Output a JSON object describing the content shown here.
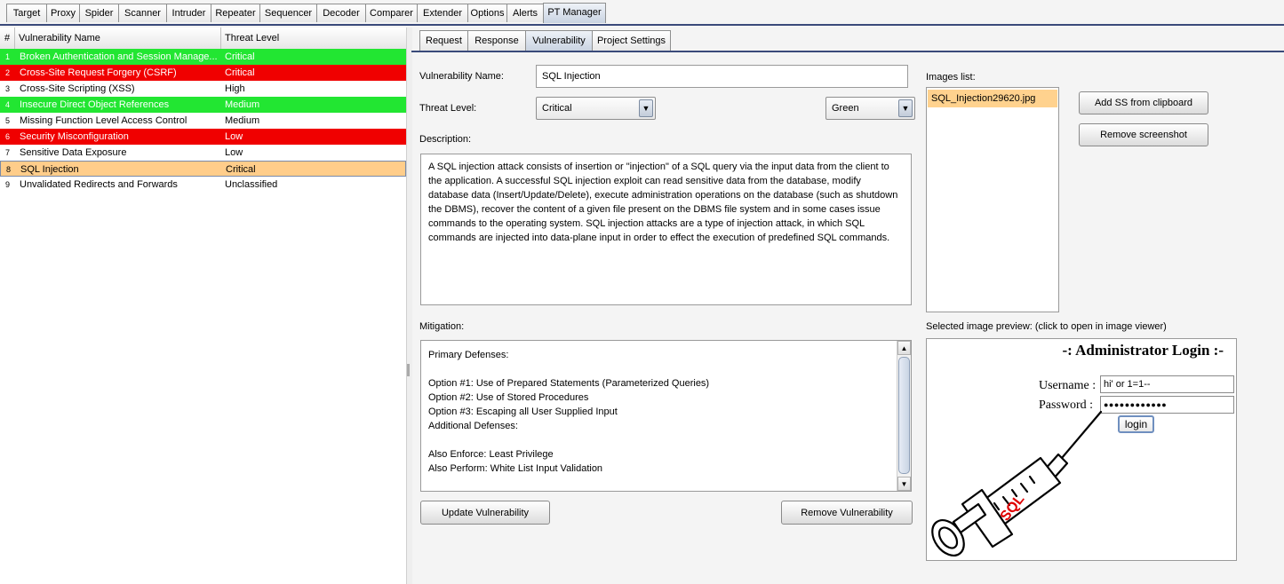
{
  "top_tabs": {
    "items": [
      {
        "label": "Target"
      },
      {
        "label": "Proxy"
      },
      {
        "label": "Spider"
      },
      {
        "label": "Scanner"
      },
      {
        "label": "Intruder"
      },
      {
        "label": "Repeater"
      },
      {
        "label": "Sequencer"
      },
      {
        "label": "Decoder"
      },
      {
        "label": "Comparer"
      },
      {
        "label": "Extender"
      },
      {
        "label": "Options"
      },
      {
        "label": "Alerts"
      },
      {
        "label": "PT Manager"
      }
    ],
    "active": "PT Manager"
  },
  "vuln_table": {
    "headers": {
      "num": "#",
      "name": "Vulnerability Name",
      "threat": "Threat Level"
    },
    "rows": [
      {
        "num": "1",
        "name": "Broken Authentication and Session Manage...",
        "threat": "Critical",
        "color": "#22e632",
        "text_color": "#ffffff"
      },
      {
        "num": "2",
        "name": "Cross-Site Request Forgery (CSRF)",
        "threat": "Critical",
        "color": "#f00000",
        "text_color": "#ffffff"
      },
      {
        "num": "3",
        "name": "Cross-Site Scripting (XSS)",
        "threat": "High",
        "color": "#ffffff",
        "text_color": "#000000"
      },
      {
        "num": "4",
        "name": "Insecure Direct Object References",
        "threat": "Medium",
        "color": "#22e632",
        "text_color": "#ffffff"
      },
      {
        "num": "5",
        "name": "Missing Function Level Access Control",
        "threat": "Medium",
        "color": "#ffffff",
        "text_color": "#000000"
      },
      {
        "num": "6",
        "name": "Security Misconfiguration",
        "threat": "Low",
        "color": "#f00000",
        "text_color": "#ffffff"
      },
      {
        "num": "7",
        "name": "Sensitive Data Exposure",
        "threat": "Low",
        "color": "#ffffff",
        "text_color": "#000000"
      },
      {
        "num": "8",
        "name": "SQL Injection",
        "threat": "Critical",
        "color": "#ffcd8a",
        "text_color": "#000000",
        "selected": true
      },
      {
        "num": "9",
        "name": "Unvalidated Redirects and Forwards",
        "threat": "Unclassified",
        "color": "#ffffff",
        "text_color": "#000000"
      }
    ]
  },
  "sub_tabs": {
    "items": [
      {
        "label": "Request"
      },
      {
        "label": "Response"
      },
      {
        "label": "Vulnerability"
      },
      {
        "label": "Project Settings"
      }
    ],
    "active": "Vulnerability"
  },
  "form": {
    "name_label": "Vulnerability Name:",
    "name_value": "SQL Injection",
    "threat_label": "Threat Level:",
    "threat_value": "Critical",
    "color_value": "Green",
    "description_label": "Description:",
    "description_text": "A SQL injection attack consists of insertion or \"injection\" of a SQL query via the input data from the client to the application. A successful SQL injection exploit can read sensitive data from the database, modify database data (Insert/Update/Delete), execute administration operations on the database (such as shutdown the DBMS), recover the content of a given file present on the DBMS file system and in some cases issue commands to the operating system. SQL injection attacks are a type of injection attack, in which SQL commands are injected into data-plane input in order to effect the execution of predefined SQL commands.",
    "mitigation_label": "Mitigation:",
    "mitigation_lines": [
      "Primary Defenses:",
      "",
      "Option #1: Use of Prepared Statements (Parameterized Queries)",
      "Option #2: Use of Stored Procedures",
      "Option #3: Escaping all User Supplied Input",
      "Additional Defenses:",
      "",
      "Also Enforce: Least Privilege",
      "Also Perform: White List Input Validation"
    ],
    "update_button": "Update Vulnerability",
    "remove_button": "Remove Vulnerability"
  },
  "images": {
    "list_label": "Images list:",
    "items": [
      "SQL_Injection29620.jpg"
    ],
    "add_button": "Add SS from clipboard",
    "remove_button": "Remove screenshot",
    "preview_label": "Selected image preview: (click to open in image viewer)"
  },
  "preview_image": {
    "title": "-: Administrator Login :-",
    "username_label": "Username :",
    "username_value": "hi' or 1=1--",
    "password_label": "Password :",
    "password_value": "●●●●●●●●●●●●",
    "login_button": "login",
    "syringe_text": "SQL"
  }
}
